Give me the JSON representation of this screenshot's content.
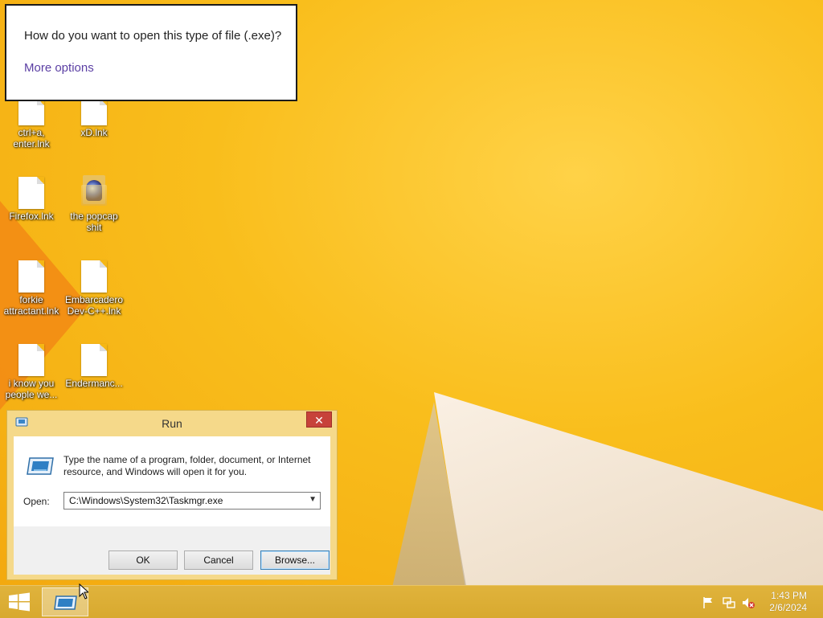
{
  "popup": {
    "question": "How do you want to open this type of file (.exe)?",
    "more_options": "More options"
  },
  "desktop_icons": [
    {
      "label": "ctrl+a,\nenter.lnk",
      "icon": "shortcut-file-icon"
    },
    {
      "label": "xD.lnk",
      "icon": "shortcut-file-icon"
    },
    {
      "label": "Firefox.lnk",
      "icon": "shortcut-file-icon"
    },
    {
      "label": "the popcap\nshit",
      "icon": "folder-icon"
    },
    {
      "label": "forkie\nattractant.lnk",
      "icon": "shortcut-file-icon"
    },
    {
      "label": "Embarcadero\nDev-C++.lnk",
      "icon": "shortcut-file-icon"
    },
    {
      "label": "i know you\npeople we...",
      "icon": "shortcut-file-icon"
    },
    {
      "label": "Endermanc...",
      "icon": "shortcut-file-icon"
    }
  ],
  "run_dialog": {
    "title": "Run",
    "description": "Type the name of a program, folder, document, or Internet resource, and Windows will open it for you.",
    "open_label": "Open:",
    "open_value": "C:\\Windows\\System32\\Taskmgr.exe",
    "ok_label": "OK",
    "cancel_label": "Cancel",
    "browse_label": "Browse...",
    "close_glyph": "✕"
  },
  "taskbar": {
    "time": "1:43 PM",
    "date": "2/6/2024"
  },
  "colors": {
    "desktop": "#f6b714",
    "link": "#5b3fa4",
    "close_button": "#c7423a"
  }
}
